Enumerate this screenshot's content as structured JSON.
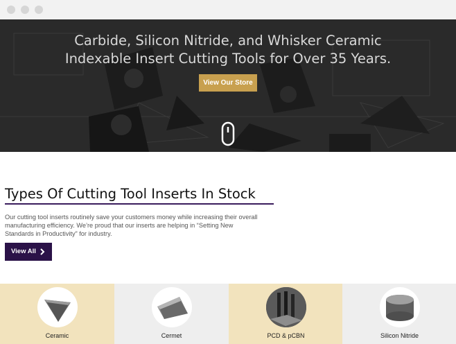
{
  "hero": {
    "title_line1": "Carbide, Silicon Nitride, and Whisker Ceramic",
    "title_line2": "Indexable Insert Cutting Tools for Over 35 Years.",
    "button_label": "View Our Store"
  },
  "section": {
    "title": "Types Of Cutting Tool Inserts In Stock",
    "desc_line1": "Our cutting tool inserts routinely save your customers money while increasing their overall",
    "desc_line2": "manufacturing efficiency. We’re proud that our inserts are helping in “Setting New",
    "desc_line3": "Standards in Productivity” for industry.",
    "button_label": "View All"
  },
  "categories": [
    {
      "label": "Ceramic"
    },
    {
      "label": "Cermet"
    },
    {
      "label": "PCD & pCBN"
    },
    {
      "label": "Silicon Nitride"
    }
  ],
  "colors": {
    "accent_gold": "#c8a04f",
    "accent_purple": "#2b1248",
    "tile_beige": "#f2e3bd",
    "tile_gray": "#eeeeee"
  }
}
